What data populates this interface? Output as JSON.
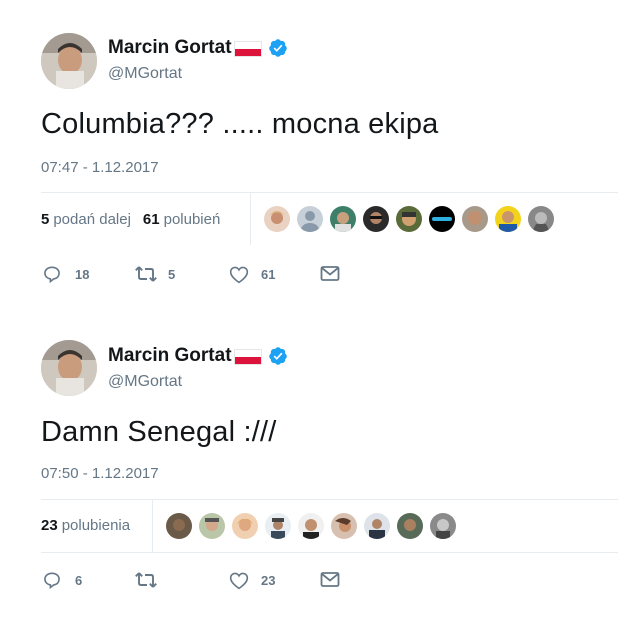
{
  "tweets": [
    {
      "name": "Marcin Gortat",
      "handle": "@MGortat",
      "text": "Columbia??? ..... mocna ekipa",
      "time": "07:47 - 1.12.2017",
      "retweets_count": "5",
      "retweets_label": "podań dalej",
      "likes_count": "61",
      "likes_label": "polubień",
      "actions": {
        "replies": "18",
        "retweets": "5",
        "likes": "61"
      }
    },
    {
      "name": "Marcin Gortat",
      "handle": "@MGortat",
      "text": "Damn Senegal :///",
      "time": "07:50 - 1.12.2017",
      "likes_count": "23",
      "likes_label": "polubienia",
      "actions": {
        "replies": "6",
        "retweets": "",
        "likes": "23"
      }
    }
  ],
  "colors": {
    "text": "#14171a",
    "muted": "#657786",
    "divider": "#e6ecf0",
    "verified": "#1da1f2",
    "flag_red": "#dc143c"
  },
  "icons": [
    "verified-badge-icon",
    "poland-flag-icon",
    "reply-icon",
    "retweet-icon",
    "like-icon",
    "direct-message-icon"
  ]
}
